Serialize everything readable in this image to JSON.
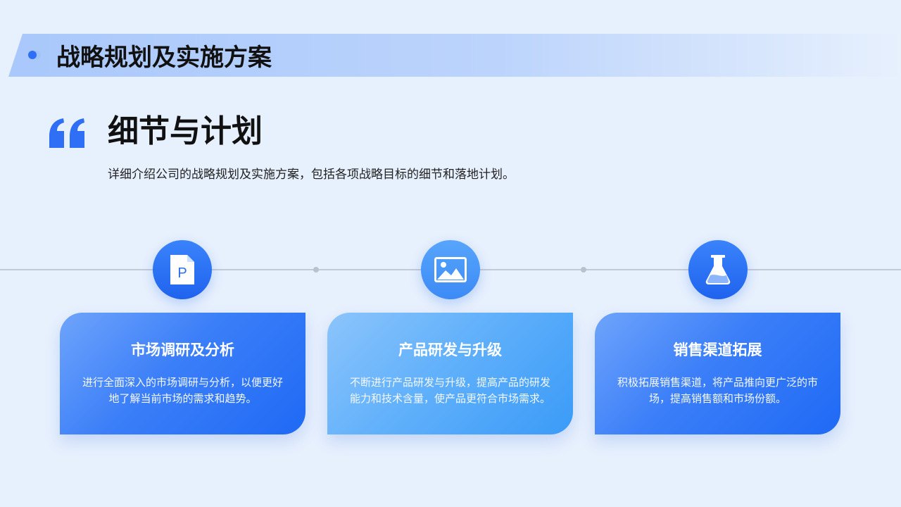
{
  "header": {
    "title": "战略规划及实施方案"
  },
  "section": {
    "title": "细节与计划",
    "description": "详细介绍公司的战略规划及实施方案，包括各项战略目标的细节和落地计划。"
  },
  "steps": [
    {
      "icon": "document-p-icon",
      "title": "市场调研及分析",
      "text": "进行全面深入的市场调研与分析，以便更好地了解当前市场的需求和趋势。"
    },
    {
      "icon": "image-icon",
      "title": "产品研发与升级",
      "text": "不断进行产品研发与升级，提高产品的研发能力和技术含量，使产品更符合市场需求。"
    },
    {
      "icon": "flask-icon",
      "title": "销售渠道拓展",
      "text": "积极拓展销售渠道，将产品推向更广泛的市场，提高销售额和市场份额。"
    }
  ],
  "icons": {
    "doc_letter": "P"
  },
  "colors": {
    "accent": "#2f6ff5",
    "card_blue": "#1f6af5",
    "card_light": "#3a9bf7",
    "background": "#e7f0fd"
  }
}
